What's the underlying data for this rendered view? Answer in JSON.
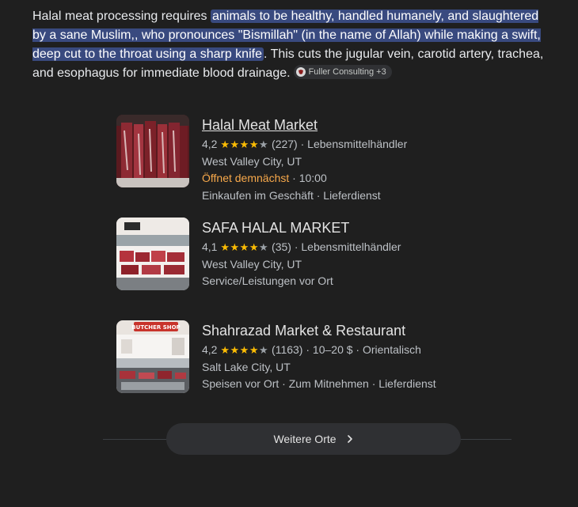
{
  "answer": {
    "intro": "Halal meat processing requires ",
    "highlight": "animals to be healthy, handled humanely, and slaughtered by a sane Muslim,, who pronounces \"Bismillah\" (in the name of Allah) while making a swift, deep cut to the throat using a sharp knife",
    "rest": ". This cuts the jugular vein, carotid artery, trachea, and esophagus for immediate blood drainage.",
    "source_chip": "Fuller Consulting +3",
    "highlight_color": "#394a7f"
  },
  "places": [
    {
      "name": "Halal Meat Market",
      "rating": "4,2",
      "stars": 4,
      "reviews": "(227)",
      "category": "Lebensmittelhändler",
      "location": "West Valley City, UT",
      "status": "Öffnet demnächst",
      "status_sep": " · ",
      "hours": "10:00",
      "services": "Einkaufen im Geschäft · Lieferdienst",
      "thumb_icon": "meat-display-photo"
    },
    {
      "name": "SAFA HALAL MARKET",
      "rating": "4,1",
      "stars": 4,
      "reviews": "(35)",
      "category": "Lebensmittelhändler",
      "location": "West Valley City, UT",
      "services": "Service/Leistungen vor Ort",
      "thumb_icon": "meat-counter-photo"
    },
    {
      "name": "Shahrazad Market & Restaurant",
      "rating": "4,2",
      "stars": 4,
      "reviews": "(1163)",
      "price": "10–20 $",
      "category": "Orientalisch",
      "location": "Salt Lake City, UT",
      "services": "Speisen vor Ort · Zum Mitnehmen · Lieferdienst",
      "thumb_sign": "BUTCHER SHOP",
      "thumb_icon": "butcher-shop-photo"
    }
  ],
  "more_button": {
    "label": "Weitere Orte",
    "icon": "chevron-right-icon"
  },
  "colors": {
    "background": "#1f1f1f",
    "star": "#fbbc04",
    "status_orange": "#f8a94b"
  }
}
